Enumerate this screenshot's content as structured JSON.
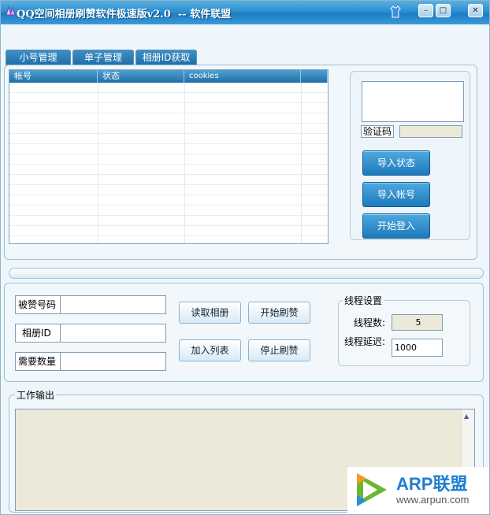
{
  "window": {
    "title": "QQ空间相册刷赞软件极速版v2.0  -- 软件联盟",
    "controls": {
      "minimize": "–",
      "maximize": "□",
      "close": "✕"
    }
  },
  "tabs": [
    {
      "label": "小号管理"
    },
    {
      "label": "单子管理"
    },
    {
      "label": "相册ID获取"
    }
  ],
  "accounts_table": {
    "columns": [
      "帐号",
      "状态",
      "cookies",
      ""
    ]
  },
  "login_panel": {
    "captcha_label": "验证码",
    "captcha_value": "",
    "buttons": {
      "import_status": "导入状态",
      "import_account": "导入帐号",
      "start_login": "开始登入"
    }
  },
  "task_form": {
    "target_qq_label": "被赞号码",
    "target_qq_value": "",
    "album_id_label": "相册ID",
    "album_id_value": "",
    "count_label": "需要数量",
    "count_value": "",
    "buttons": {
      "read_album": "读取相册",
      "start_like": "开始刷赞",
      "add_to_list": "加入列表",
      "stop_like": "停止刷赞"
    }
  },
  "thread_settings": {
    "title": "线程设置",
    "thread_count_label": "线程数:",
    "thread_count_value": "5",
    "thread_delay_label": "线程延迟:",
    "thread_delay_value": "1000"
  },
  "output": {
    "title": "工作输出",
    "scroll_up": "▲"
  },
  "watermark": {
    "brand": "ARP联盟",
    "url": "www.arpun.com"
  },
  "colors": {
    "title_bar": "#2a8fd0",
    "button": "#1d79bb",
    "window_bg": "#eef6fb"
  }
}
